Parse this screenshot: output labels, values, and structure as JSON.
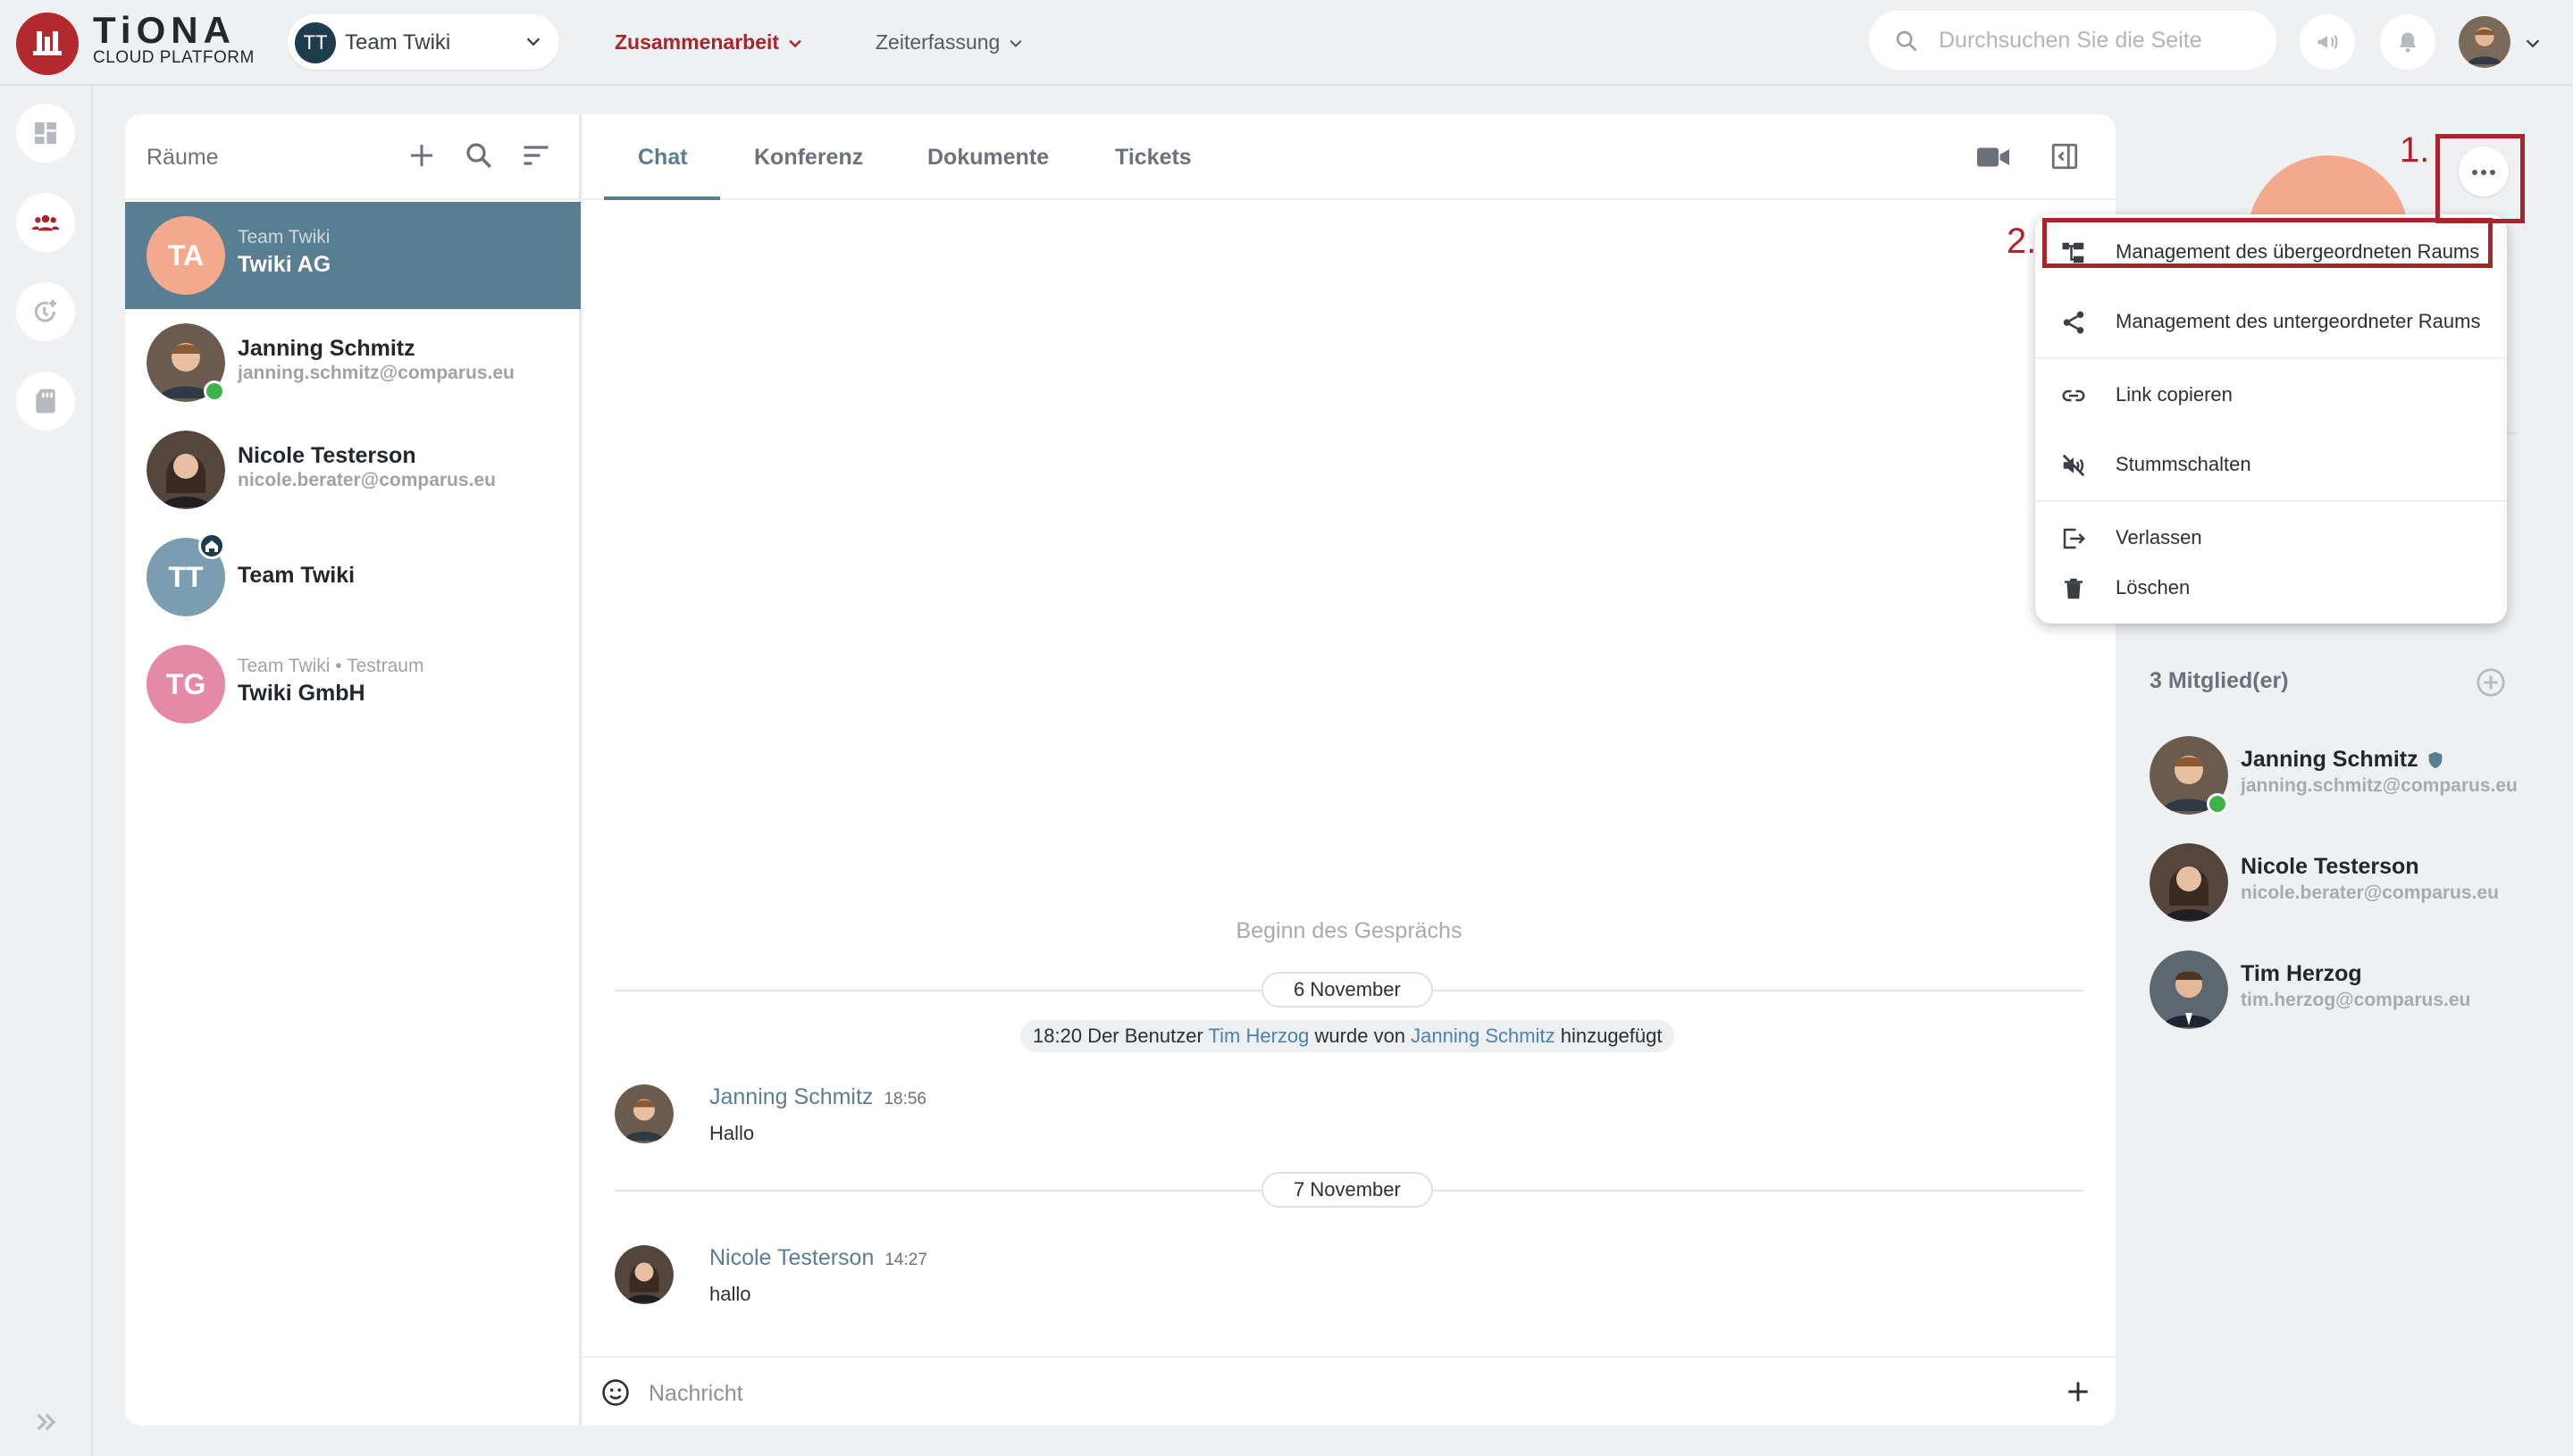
{
  "colors": {
    "brand": "#b22a2e",
    "accent": "#5a7e91",
    "online": "#3cb34a",
    "annotation": "#a8262b"
  },
  "app": {
    "logo_title": "TiONA",
    "logo_subtitle": "CLOUD PLATFORM",
    "team_selector": {
      "initials": "TT",
      "label": "Team Twiki"
    },
    "nav": [
      {
        "label": "Zusammenarbeit",
        "active": true
      },
      {
        "label": "Zeiterfassung",
        "active": false
      }
    ],
    "search": {
      "placeholder": "Durchsuchen Sie die Seite",
      "value": ""
    },
    "icons": {
      "announcement": "megaphone-icon",
      "notifications": "bell-icon",
      "user": "user-avatar"
    }
  },
  "rail": {
    "items": [
      {
        "name": "dashboard",
        "icon": "dashboard-icon"
      },
      {
        "name": "collaboration",
        "icon": "group-icon",
        "active": true
      },
      {
        "name": "time-tracking",
        "icon": "clock-plus-icon"
      },
      {
        "name": "documents",
        "icon": "sd-card-icon"
      }
    ],
    "expand_icon": "double-chevron-right-icon"
  },
  "rooms": {
    "title": "Räume",
    "items": [
      {
        "initials": "TA",
        "subtitle": "Team Twiki",
        "name": "Twiki AG",
        "color": "#f4a98d",
        "active": true
      },
      {
        "name": "Janning Schmitz",
        "email": "janning.schmitz@comparus.eu",
        "online": true
      },
      {
        "name": "Nicole Testerson",
        "email": "nicole.berater@comparus.eu"
      },
      {
        "initials": "TT",
        "name": "Team Twiki",
        "color": "#7a9db2",
        "home": true
      },
      {
        "initials": "TG",
        "subtitle": "Team Twiki • Testraum",
        "name": "Twiki GmbH",
        "color": "#e58aa6"
      }
    ]
  },
  "chat": {
    "tabs": [
      {
        "label": "Chat",
        "active": true
      },
      {
        "label": "Konferenz"
      },
      {
        "label": "Dokumente"
      },
      {
        "label": "Tickets"
      }
    ],
    "conversation_start": "Beginn des Gesprächs",
    "days": [
      {
        "label": "6 November",
        "system": {
          "time": "18:20",
          "pre": "Der Benutzer",
          "user": "Tim Herzog",
          "mid": "wurde von",
          "by": "Janning Schmitz",
          "post": "hinzugefügt"
        },
        "messages": [
          {
            "author": "Janning Schmitz",
            "time": "18:56",
            "text": "Hallo"
          }
        ]
      },
      {
        "label": "7 November",
        "messages": [
          {
            "author": "Nicole Testerson",
            "time": "14:27",
            "text": "hallo"
          }
        ]
      }
    ],
    "composer": {
      "placeholder": "Nachricht",
      "value": ""
    }
  },
  "room_menu": {
    "items": [
      {
        "label": "Management des übergeordneten Raums",
        "icon": "hierarchy-icon"
      },
      {
        "label": "Management des untergeordneter Raums",
        "icon": "share-icon"
      },
      {
        "label": "Link copieren",
        "icon": "link-icon"
      },
      {
        "label": "Stummschalten",
        "icon": "mute-icon"
      },
      {
        "label": "Verlassen",
        "icon": "exit-icon"
      },
      {
        "label": "Löschen",
        "icon": "trash-icon"
      }
    ]
  },
  "members": {
    "title": "3 Mitglied(er)",
    "items": [
      {
        "name": "Janning Schmitz",
        "email": "janning.schmitz@comparus.eu",
        "admin": true,
        "online": true
      },
      {
        "name": "Nicole Testerson",
        "email": "nicole.berater@comparus.eu"
      },
      {
        "name": "Tim Herzog",
        "email": "tim.herzog@comparus.eu"
      }
    ]
  },
  "annotations": {
    "step1": "1.",
    "step2": "2."
  }
}
